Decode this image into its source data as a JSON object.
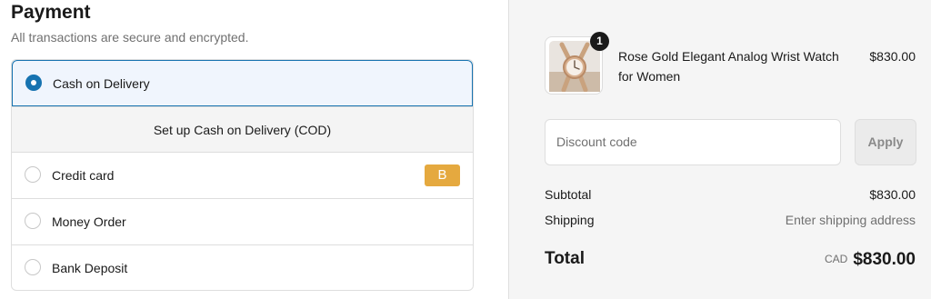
{
  "payment": {
    "title": "Payment",
    "subtitle": "All transactions are secure and encrypted.",
    "methods": [
      {
        "label": "Cash on Delivery",
        "selected": true
      },
      {
        "label": "Credit card",
        "selected": false,
        "badge": "B"
      },
      {
        "label": "Money Order",
        "selected": false
      },
      {
        "label": "Bank Deposit",
        "selected": false
      }
    ],
    "cod_info": "Set up Cash on Delivery (COD)"
  },
  "summary": {
    "product": {
      "name": "Rose Gold Elegant Analog Wrist Watch for Women",
      "price": "$830.00",
      "quantity": "1",
      "image_icon": "watch-image"
    },
    "discount": {
      "placeholder": "Discount code",
      "apply_label": "Apply"
    },
    "subtotal_label": "Subtotal",
    "subtotal_value": "$830.00",
    "shipping_label": "Shipping",
    "shipping_value": "Enter shipping address",
    "total_label": "Total",
    "total_currency": "CAD",
    "total_value": "$830.00"
  },
  "colors": {
    "accent": "#1773b0",
    "badge": "#e5a93f",
    "summary_bg": "#f5f5f5"
  }
}
